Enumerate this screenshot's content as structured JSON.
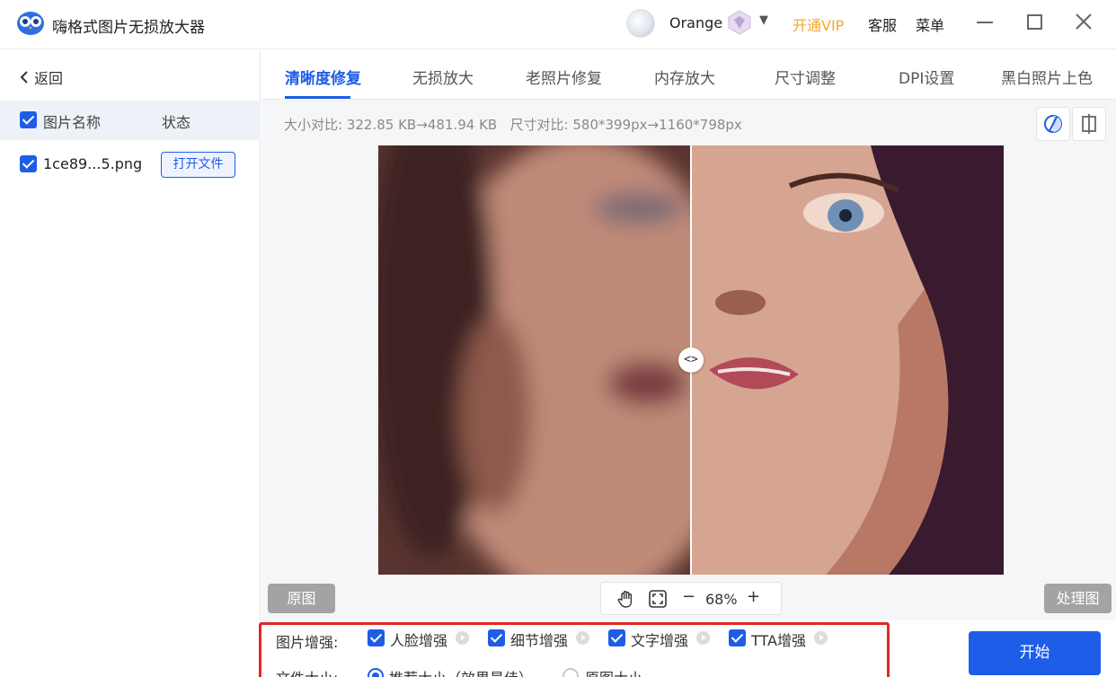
{
  "app": {
    "title": "嗨格式图片无损放大器"
  },
  "user": {
    "name": "Orange",
    "vip_link": "开通VIP",
    "service": "客服",
    "menu": "菜单"
  },
  "left": {
    "back": "返回",
    "header": {
      "name": "图片名称",
      "status": "状态"
    },
    "files": [
      {
        "name": "1ce89...5.png",
        "action": "打开文件"
      }
    ]
  },
  "tabs": [
    {
      "label": "清晰度修复",
      "active": true
    },
    {
      "label": "无损放大"
    },
    {
      "label": "老照片修复"
    },
    {
      "label": "内存放大"
    },
    {
      "label": "尺寸调整"
    },
    {
      "label": "DPI设置"
    },
    {
      "label": "黑白照片上色"
    }
  ],
  "info": {
    "size_label": "大小对比:",
    "size_from": "322.85 KB",
    "size_to": "481.94 KB",
    "dim_label": "尺寸对比:",
    "dim_from": "580*399px",
    "dim_to": "1160*798px",
    "arrow": "→"
  },
  "viewer": {
    "original_label": "原图",
    "processed_label": "处理图",
    "zoom": "68%",
    "zoom_minus": "−",
    "zoom_plus": "+",
    "handle": "<>"
  },
  "options": {
    "enhance_label": "图片增强:",
    "enhance": [
      {
        "label": "人脸增强",
        "checked": true
      },
      {
        "label": "细节增强",
        "checked": true
      },
      {
        "label": "文字增强",
        "checked": true
      },
      {
        "label": "TTA增强",
        "checked": true
      }
    ],
    "size_label": "文件大小:",
    "size_options": [
      {
        "label": "推荐大小（效果最佳）",
        "selected": true
      },
      {
        "label": "原图大小",
        "selected": false
      }
    ],
    "start": "开始"
  },
  "colors": {
    "accent": "#1d5de8",
    "vip": "#f5a623",
    "highlight_box": "#e32626"
  }
}
